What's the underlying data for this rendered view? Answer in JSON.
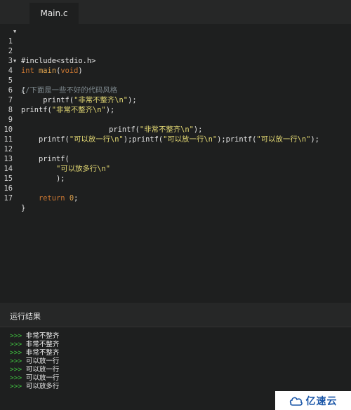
{
  "tab": {
    "label": "Main.c"
  },
  "editor": {
    "line_numbers": [
      "1",
      "2",
      "3",
      "4",
      "5",
      "6",
      "7",
      "8",
      "9",
      "10",
      "11",
      "12",
      "13",
      "14",
      "15",
      "16",
      "17"
    ],
    "lines": [
      [
        "#include<stdio.h>"
      ],
      [
        ""
      ],
      [
        "int",
        " ",
        "main",
        "(",
        "void",
        ")"
      ],
      [
        "{"
      ],
      [
        "//下面是一些不好的代码风格"
      ],
      [
        "     printf(",
        "\"非常不整齐\\n\"",
        ");"
      ],
      [
        "printf(",
        "\"非常不整齐\\n\"",
        ");"
      ],
      [
        ""
      ],
      [
        "                    printf(",
        "\"非常不整齐\\n\"",
        ");"
      ],
      [
        "    printf(",
        "\"可以放一行\\n\"",
        ");printf(",
        "\"可以放一行\\n\"",
        ");printf(",
        "\"可以放一行\\n\"",
        ");"
      ],
      [
        ""
      ],
      [
        "    printf("
      ],
      [
        "        ",
        "\"可以放多行\\n\""
      ],
      [
        "        );"
      ],
      [
        ""
      ],
      [
        "    ",
        "return",
        " ",
        "0",
        ";"
      ],
      [
        "}"
      ]
    ]
  },
  "results": {
    "title": "运行结果",
    "prompt": ">>>",
    "lines": [
      "非常不整齐",
      "非常不整齐",
      "非常不整齐",
      "可以放一行",
      "可以放一行",
      "可以放一行",
      "可以放多行"
    ]
  },
  "watermark": {
    "text": "亿速云"
  }
}
